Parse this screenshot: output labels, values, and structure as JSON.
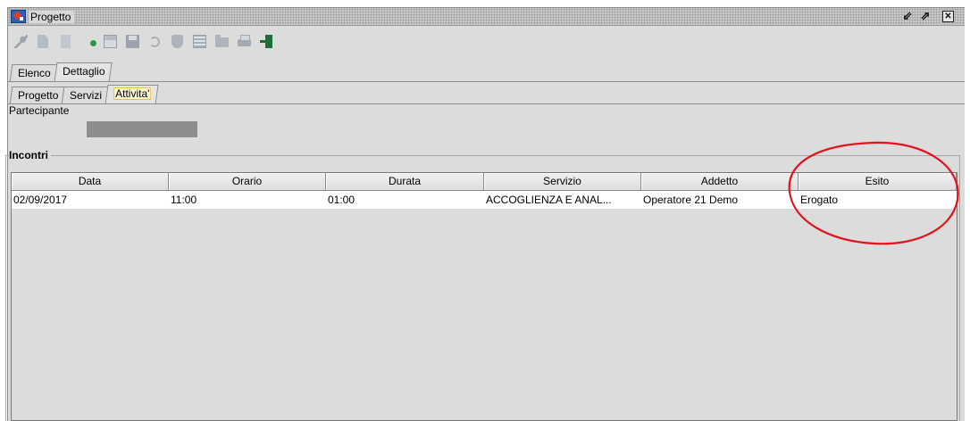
{
  "window": {
    "title": "Progetto",
    "restore_glyph": "⇙",
    "maximize_glyph": "⇗",
    "close_glyph": "✕"
  },
  "toolbar": {
    "icons": [
      "key-icon",
      "edit-icon",
      "document-icon",
      "info-icon",
      "save-copy-icon",
      "floppy-icon",
      "undo-icon",
      "shield-icon",
      "grid-icon",
      "folder-icon",
      "print-icon",
      "exit-icon"
    ]
  },
  "tabs": {
    "outer": [
      "Elenco",
      "Dettaglio"
    ],
    "outer_active": "Dettaglio",
    "inner": [
      "Progetto",
      "Servizi",
      "Attivita'"
    ],
    "inner_active": "Attivita'"
  },
  "participant": {
    "label": "Partecipante",
    "value": ""
  },
  "group": {
    "title": "Incontri"
  },
  "table": {
    "columns": [
      "Data",
      "Orario",
      "Durata",
      "Servizio",
      "Addetto",
      "Esito"
    ],
    "rows": [
      [
        "02/09/2017",
        "11:00",
        "01:00",
        "ACCOGLIENZA E ANAL...",
        "Operatore 21 Demo",
        "Erogato"
      ]
    ]
  },
  "colors": {
    "annotation": "#e0141e",
    "background": "#dcdcdc"
  }
}
